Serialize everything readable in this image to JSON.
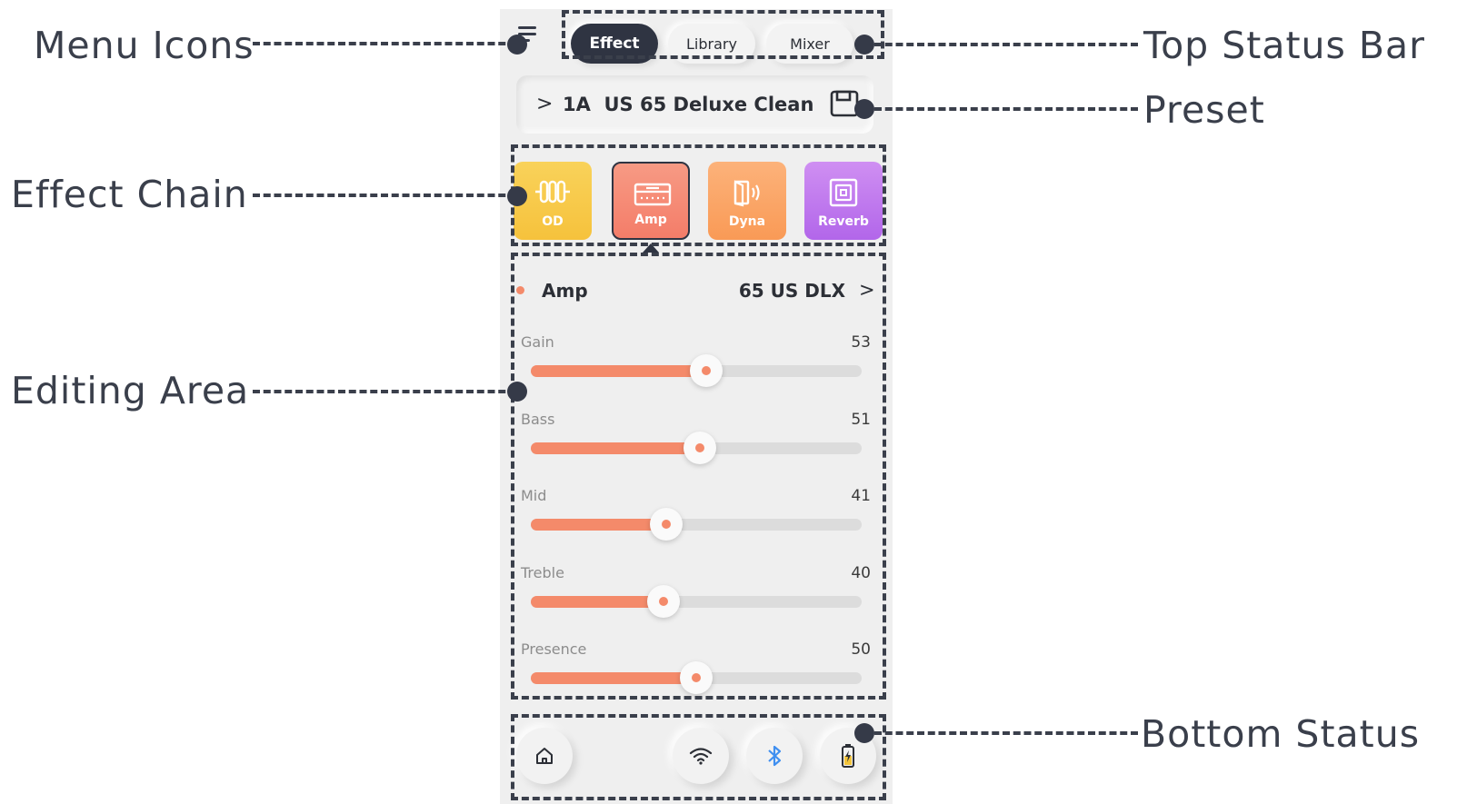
{
  "annotations": {
    "menu_icons": "Menu Icons",
    "top_status_bar": "Top Status Bar",
    "preset": "Preset",
    "effect_chain": "Effect Chain",
    "editing_area": "Editing Area",
    "bottom_status": "Bottom Status"
  },
  "tabs": [
    {
      "label": "Effect",
      "active": true
    },
    {
      "label": "Library",
      "active": false
    },
    {
      "label": "Mixer",
      "active": false
    }
  ],
  "preset": {
    "expand_glyph": ">",
    "name": "1A  US 65 Deluxe Clean",
    "save_icon": "save-icon"
  },
  "effects": [
    {
      "label": "OD",
      "icon": "overdrive-icon",
      "color_top": "#f9d25a",
      "color_bottom": "#f6c23c",
      "selected": false
    },
    {
      "label": "Amp",
      "icon": "amp-icon",
      "color_top": "#f79a84",
      "color_bottom": "#f47d69",
      "selected": true
    },
    {
      "label": "Dyna",
      "icon": "dynamics-icon",
      "color_top": "#fcb27a",
      "color_bottom": "#f99a56",
      "selected": false
    },
    {
      "label": "Reverb",
      "icon": "reverb-icon",
      "color_top": "#cf8ff2",
      "color_bottom": "#b266ea",
      "selected": false
    }
  ],
  "editor": {
    "title": "Amp",
    "model": "65 US DLX",
    "model_arrow": ">",
    "accent": "#f48a6a",
    "params": [
      {
        "label": "Gain",
        "value": "53",
        "fraction": 0.53
      },
      {
        "label": "Bass",
        "value": "51",
        "fraction": 0.51
      },
      {
        "label": "Mid",
        "value": "41",
        "fraction": 0.41
      },
      {
        "label": "Treble",
        "value": "40",
        "fraction": 0.4
      },
      {
        "label": "Presence",
        "value": "50",
        "fraction": 0.5
      }
    ]
  },
  "bottom_bar": {
    "icons": [
      "home-icon",
      "wifi-icon",
      "bluetooth-icon",
      "battery-icon"
    ]
  }
}
